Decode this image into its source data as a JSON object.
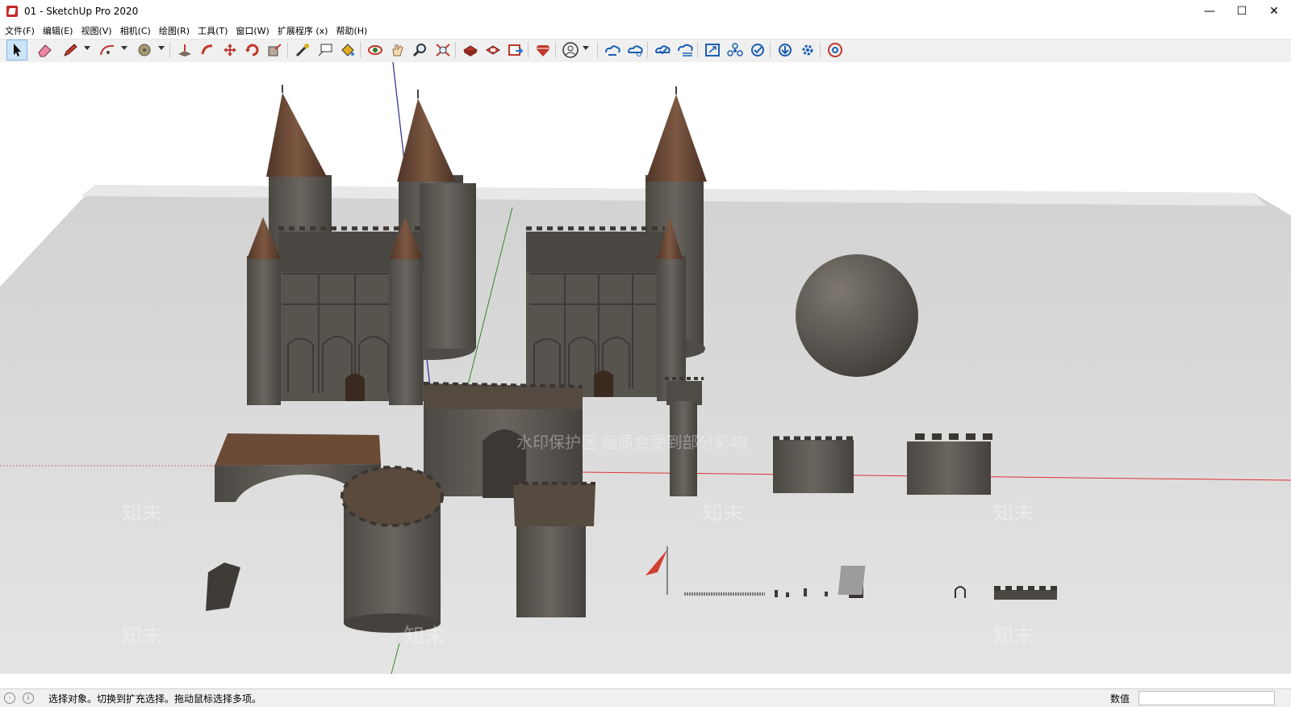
{
  "window": {
    "title": "01 - SketchUp Pro 2020",
    "minimize": "—",
    "maximize": "☐",
    "close": "✕"
  },
  "menu": [
    "文件(F)",
    "编辑(E)",
    "视图(V)",
    "相机(C)",
    "绘图(R)",
    "工具(T)",
    "窗口(W)",
    "扩展程序 (x)",
    "帮助(H)"
  ],
  "toolbar": {
    "icons": [
      "select-icon",
      "eraser-icon",
      "pencil-icon",
      "arc-icon",
      "tape-icon",
      "push-pull-icon",
      "follow-me-icon",
      "move-icon",
      "rotate-icon",
      "scale-icon",
      "measure-icon",
      "text-icon",
      "paint-bucket-icon",
      "orbit-icon",
      "pan-icon",
      "zoom-icon",
      "zoom-extents-icon",
      "warehouse-icon",
      "extension-warehouse-icon",
      "send-to-layout-icon",
      "ruby-console-icon",
      "account-icon",
      "cloud-sync-icon",
      "cloud-share-icon",
      "cloud-upload-icon",
      "cloud-list-icon",
      "scale-figure-icon",
      "components-icon",
      "check-icon",
      "download-icon",
      "settings-icon",
      "chrome-icon"
    ],
    "accent": "#1a5fb4"
  },
  "viewport": {
    "watermark_main": "水印保护区  画质会受到部分影响",
    "watermark_tile": "知末",
    "ground_color": "#d8d8d8",
    "stone_color": "#5c5852",
    "roof_color": "#6b4a36"
  },
  "status": {
    "message": "选择对象。切换到扩充选择。拖动鼠标选择多项。",
    "measure_label": "数值",
    "measure_value": ""
  }
}
